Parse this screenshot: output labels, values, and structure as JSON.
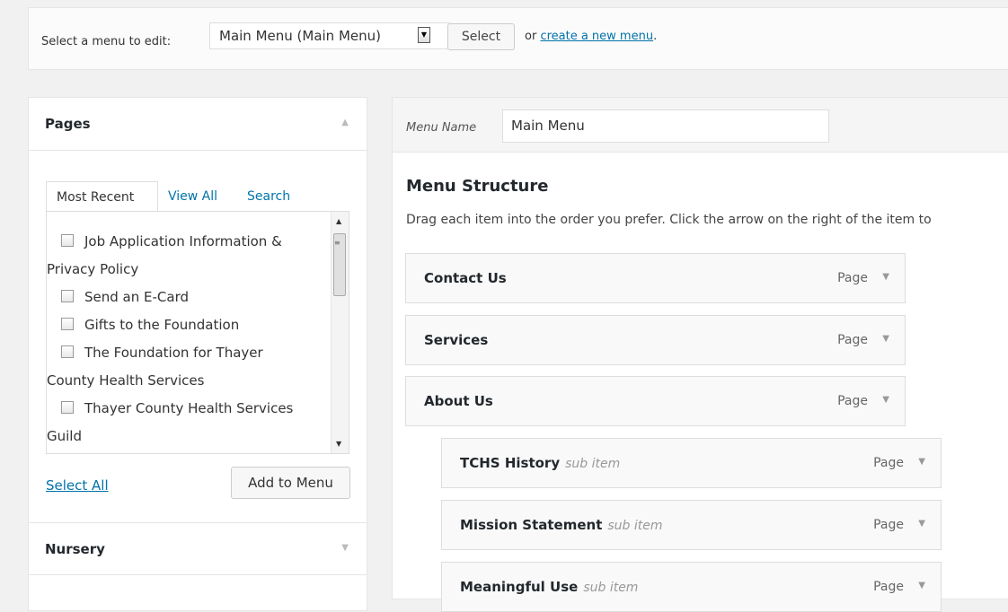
{
  "topbar": {
    "label": "Select a menu to edit:",
    "selected_menu": "Main Menu (Main Menu)",
    "select_button": "Select",
    "or_text": "or ",
    "create_link": "create a new menu",
    "period": "."
  },
  "pages_box": {
    "title": "Pages",
    "tabs": [
      "Most Recent",
      "View All",
      "Search"
    ],
    "items": [
      {
        "first": "Job Application Information &",
        "cont": "Privacy Policy"
      },
      {
        "first": "Send an E-Card",
        "cont": ""
      },
      {
        "first": "Gifts to the Foundation",
        "cont": ""
      },
      {
        "first": "The Foundation for Thayer",
        "cont": "County Health Services"
      },
      {
        "first": "Thayer County Health Services",
        "cont": "Guild"
      }
    ],
    "select_all": "Select All",
    "add_button": "Add to Menu"
  },
  "nursery_box": {
    "title": "Nursery"
  },
  "menu": {
    "name_label": "Menu Name",
    "name_value": "Main Menu",
    "structure_title": "Menu Structure",
    "structure_desc": "Drag each item into the order you prefer. Click the arrow on the right of the item to",
    "items": [
      {
        "name": "Contact Us",
        "sub": "",
        "type": "Page"
      },
      {
        "name": "Services",
        "sub": "",
        "type": "Page"
      },
      {
        "name": "About Us",
        "sub": "",
        "type": "Page"
      },
      {
        "name": "TCHS History",
        "sub": "sub item",
        "type": "Page"
      },
      {
        "name": "Mission Statement",
        "sub": "sub item",
        "type": "Page"
      },
      {
        "name": "Meaningful Use",
        "sub": "sub item",
        "type": "Page"
      }
    ]
  }
}
